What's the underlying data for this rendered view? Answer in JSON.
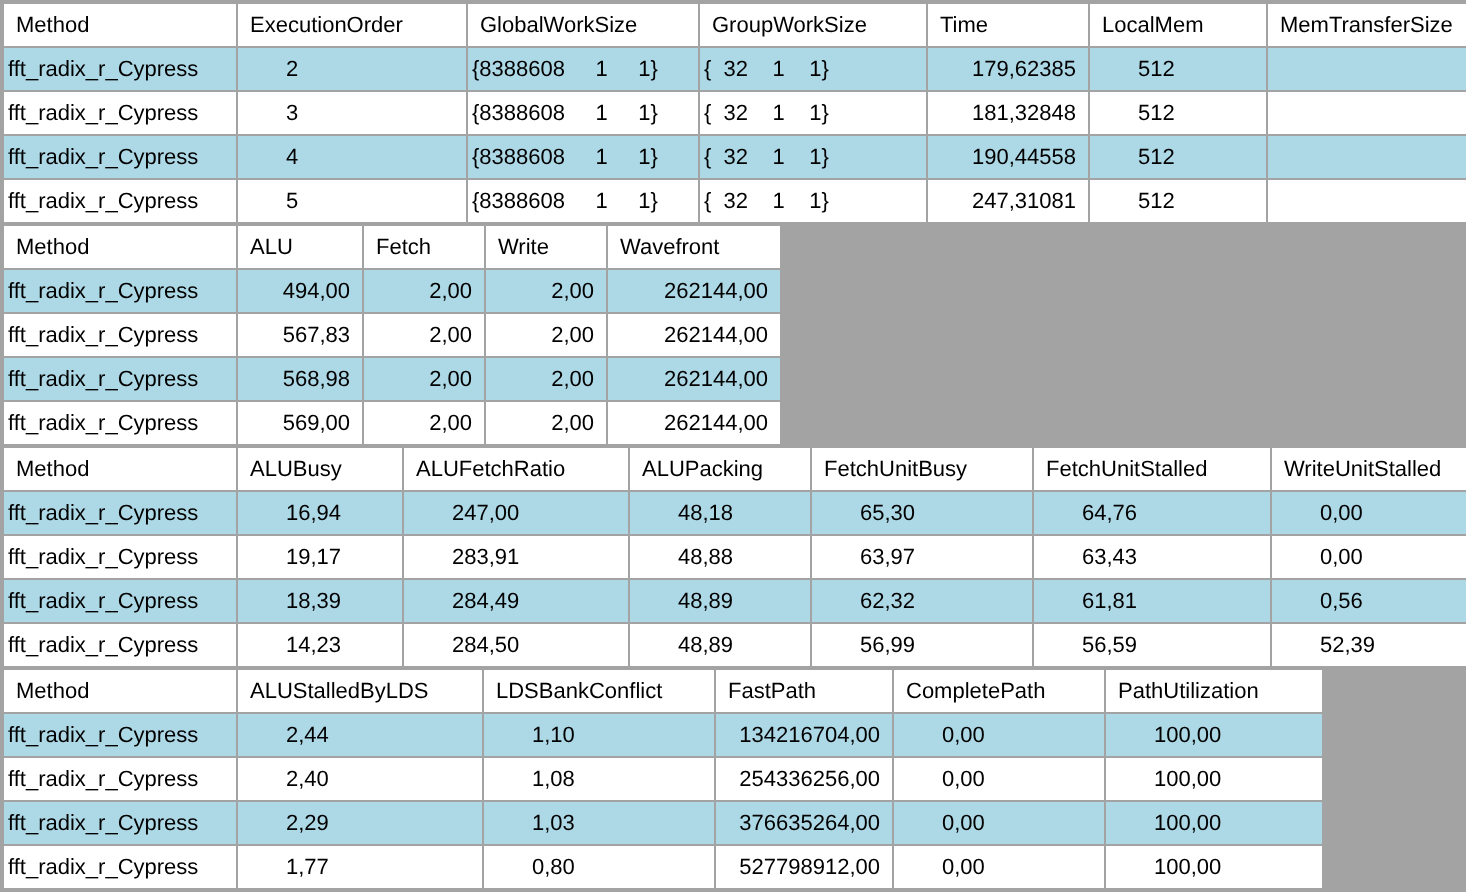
{
  "tables": [
    {
      "columns": [
        "Method",
        "ExecutionOrder",
        "GlobalWorkSize",
        "GroupWorkSize",
        "Time",
        "LocalMem",
        "MemTransferSize"
      ],
      "rows": [
        [
          "fft_radix_r_Cypress",
          "2",
          "{8388608     1     1}",
          "{  32    1    1}",
          "179,62385",
          "512"
        ],
        [
          "fft_radix_r_Cypress",
          "3",
          "{8388608     1     1}",
          "{  32    1    1}",
          "181,32848",
          "512"
        ],
        [
          "fft_radix_r_Cypress",
          "4",
          "{8388608     1     1}",
          "{  32    1    1}",
          "190,44558",
          "512"
        ],
        [
          "fft_radix_r_Cypress",
          "5",
          "{8388608     1     1}",
          "{  32    1    1}",
          "247,31081",
          "512"
        ]
      ]
    },
    {
      "columns": [
        "Method",
        "ALU",
        "Fetch",
        "Write",
        "Wavefront"
      ],
      "rows": [
        [
          "fft_radix_r_Cypress",
          "494,00",
          "2,00",
          "2,00",
          "262144,00"
        ],
        [
          "fft_radix_r_Cypress",
          "567,83",
          "2,00",
          "2,00",
          "262144,00"
        ],
        [
          "fft_radix_r_Cypress",
          "568,98",
          "2,00",
          "2,00",
          "262144,00"
        ],
        [
          "fft_radix_r_Cypress",
          "569,00",
          "2,00",
          "2,00",
          "262144,00"
        ]
      ]
    },
    {
      "columns": [
        "Method",
        "ALUBusy",
        "ALUFetchRatio",
        "ALUPacking",
        "FetchUnitBusy",
        "FetchUnitStalled",
        "WriteUnitStalled"
      ],
      "rows": [
        [
          "fft_radix_r_Cypress",
          "16,94",
          "247,00",
          "48,18",
          "65,30",
          "64,76",
          "0,00"
        ],
        [
          "fft_radix_r_Cypress",
          "19,17",
          "283,91",
          "48,88",
          "63,97",
          "63,43",
          "0,00"
        ],
        [
          "fft_radix_r_Cypress",
          "18,39",
          "284,49",
          "48,89",
          "62,32",
          "61,81",
          "0,56"
        ],
        [
          "fft_radix_r_Cypress",
          "14,23",
          "284,50",
          "48,89",
          "56,99",
          "56,59",
          "52,39"
        ]
      ]
    },
    {
      "columns": [
        "Method",
        "ALUStalledByLDS",
        "LDSBankConflict",
        "FastPath",
        "CompletePath",
        "PathUtilization"
      ],
      "rows": [
        [
          "fft_radix_r_Cypress",
          "2,44",
          "1,10",
          "134216704,00",
          "0,00",
          "100,00"
        ],
        [
          "fft_radix_r_Cypress",
          "2,40",
          "1,08",
          "254336256,00",
          "0,00",
          "100,00"
        ],
        [
          "fft_radix_r_Cypress",
          "2,29",
          "1,03",
          "376635264,00",
          "0,00",
          "100,00"
        ],
        [
          "fft_radix_r_Cypress",
          "1,77",
          "0,80",
          "527798912,00",
          "0,00",
          "100,00"
        ]
      ]
    }
  ]
}
